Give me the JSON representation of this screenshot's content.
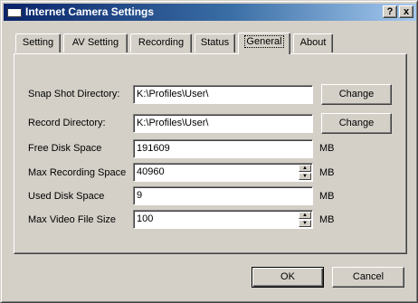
{
  "window": {
    "title": "Internet Camera Settings",
    "help_label": "?",
    "close_label": "x"
  },
  "tabs": [
    {
      "label": "Setting",
      "active": false
    },
    {
      "label": "AV Setting",
      "active": false
    },
    {
      "label": "Recording",
      "active": false
    },
    {
      "label": "Status",
      "active": false
    },
    {
      "label": "General",
      "active": true
    },
    {
      "label": "About",
      "active": false
    }
  ],
  "general": {
    "snapshot_dir": {
      "label": "Snap Shot Directory:",
      "value": "K:\\Profiles\\User\\",
      "button": "Change"
    },
    "record_dir": {
      "label": "Record Directory:",
      "value": "K:\\Profiles\\User\\",
      "button": "Change"
    },
    "free_disk": {
      "label": "Free Disk Space",
      "value": "191609",
      "unit": "MB"
    },
    "max_recording": {
      "label": "Max Recording Space",
      "value": "40960",
      "unit": "MB"
    },
    "used_disk": {
      "label": "Used Disk Space",
      "value": "9",
      "unit": "MB"
    },
    "max_video": {
      "label": "Max Video File Size",
      "value": "100",
      "unit": "MB"
    }
  },
  "footer": {
    "ok_label": "OK",
    "cancel_label": "Cancel"
  }
}
